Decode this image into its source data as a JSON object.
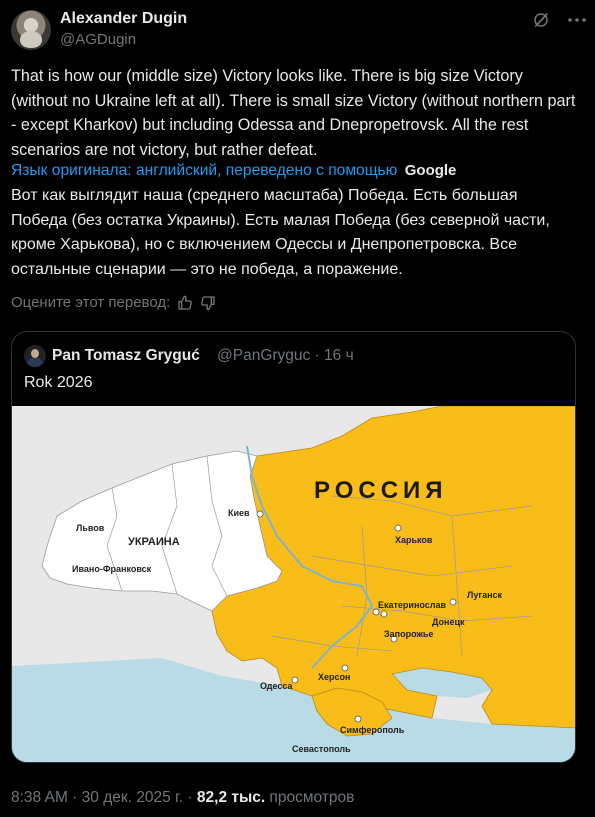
{
  "author": {
    "display_name": "Alexander Dugin",
    "handle": "@AGDugin"
  },
  "icons": {
    "grok": "grok-icon",
    "more": "more-icon",
    "thumbs_up": "thumbs-up-icon",
    "thumbs_down": "thumbs-down-icon"
  },
  "tweet": {
    "text": "That is how our (middle size) Victory looks like. There is big size Victory (without no Ukraine left at all). There is small size Victory (without northern part - except Kharkov) but including Odessa and Dnepropetrovsk. All the rest scenarios are not victory, but rather defeat.",
    "translated_from": "Язык оригинала: английский, переведено с помощью",
    "translator_name": "Google",
    "translation": "Вот как выглядит наша (среднего масштаба) Победа. Есть большая Победа (без остатка Украины). Есть малая Победа (без северной части, кроме Харькова), но с включением Одессы и Днепропетровска. Все остальные сценарии — это не победа, а поражение.",
    "rate_prompt": "Оцените этот перевод:"
  },
  "quote": {
    "display_name": "Pan Tomasz Gryguć",
    "meta": "@PanGryguc · 16 ч",
    "text": "Rok 2026",
    "map": {
      "title": "РОССИЯ",
      "labels": {
        "ukraine": "УКРАИНА",
        "lvov": "Львов",
        "ivano_frankovsk": "Ивано-Франковск",
        "kiev": "Киев",
        "kharkov": "Харьков",
        "lugansk": "Луганск",
        "ekaterinoslav": "Екатеринослав",
        "donetsk": "Донецк",
        "zaporozhe": "Запорожье",
        "odessa": "Одесса",
        "kherson": "Херсон",
        "simferopol": "Симферополь",
        "sevastopol": "Севастополь"
      },
      "colors": {
        "russia": "#f9bd1a",
        "ukraine": "#ffffff",
        "neighbors": "#e8e8e8",
        "sea": "#b9dbe6",
        "borders": "#9a9a9a"
      }
    }
  },
  "footer": {
    "time": "8:38 AM · 30 дек. 2025 г. · ",
    "views_count": "82,2 тыс.",
    "views_label": " просмотров"
  }
}
